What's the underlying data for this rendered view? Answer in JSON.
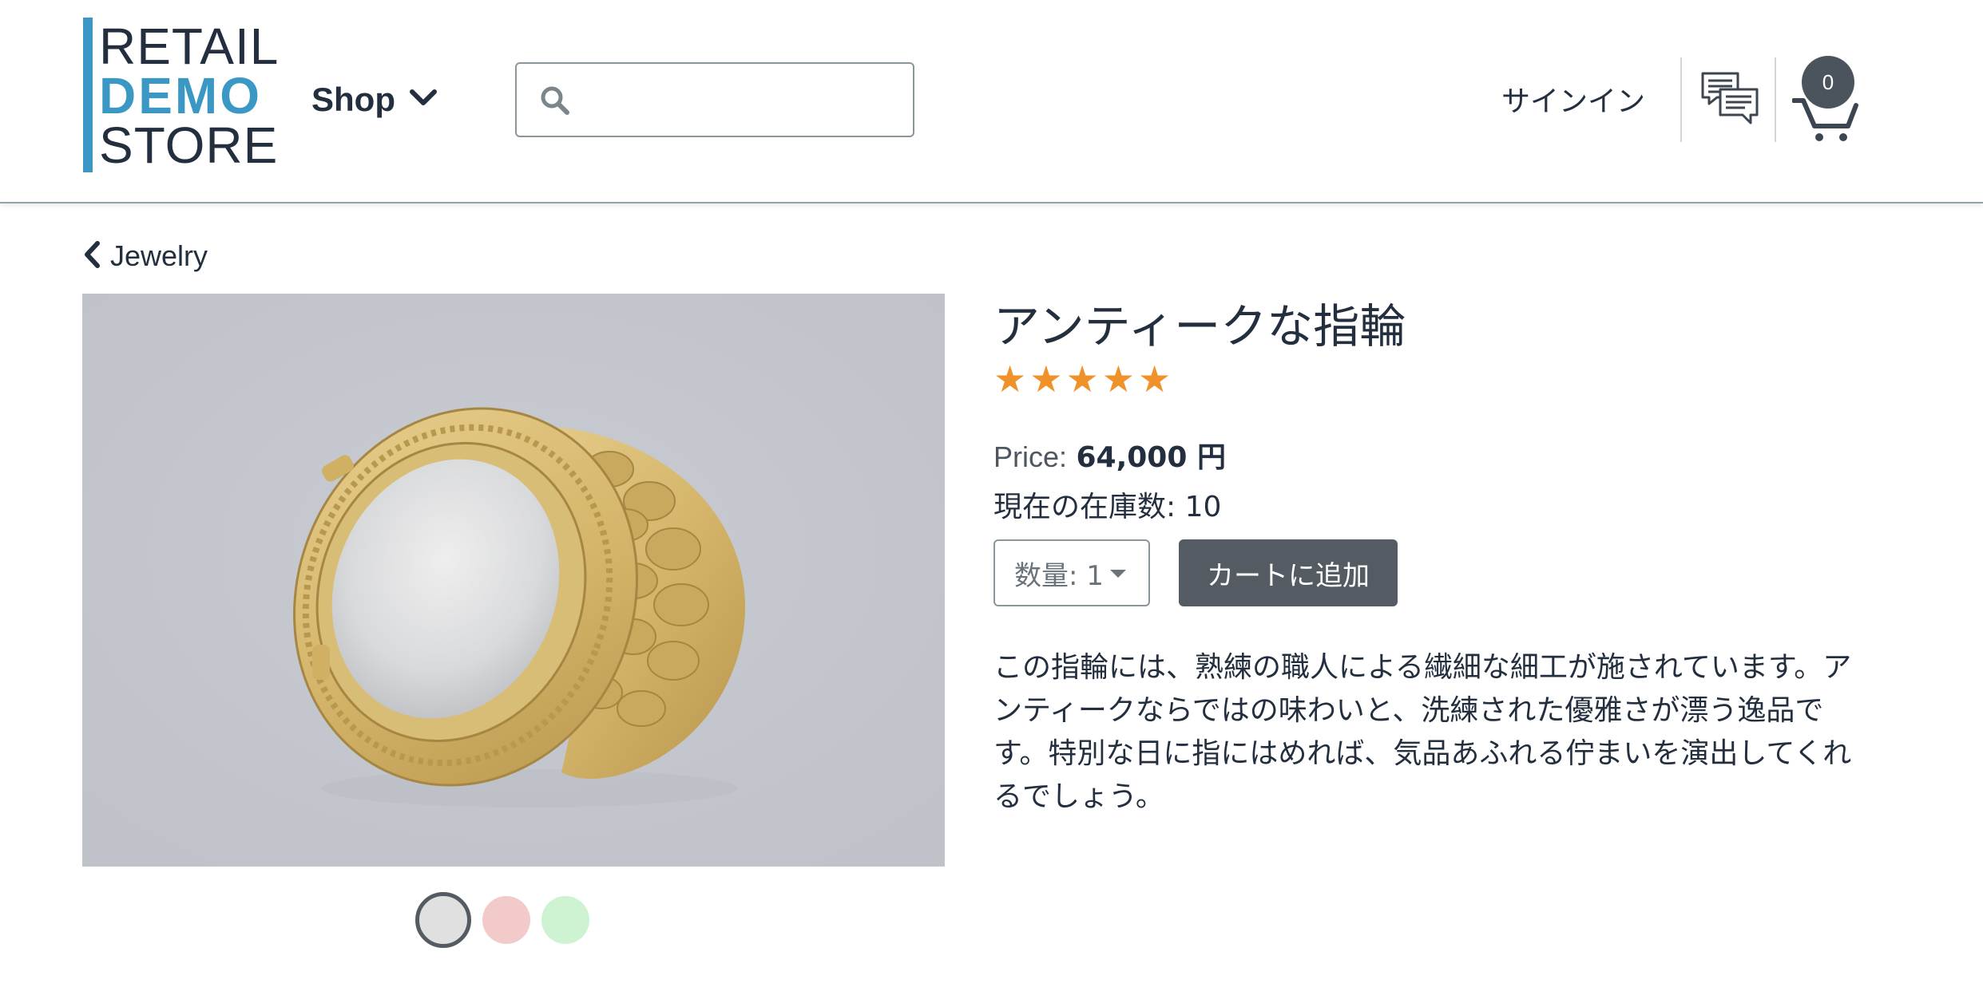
{
  "header": {
    "logo": {
      "line1": "RETAIL",
      "line2": "DEMO",
      "line3": "STORE"
    },
    "shop_label": "Shop",
    "search": {
      "placeholder": "",
      "value": ""
    },
    "signin_label": "サインイン",
    "cart_count": "0"
  },
  "breadcrumb": {
    "label": "Jewelry"
  },
  "product": {
    "title": "アンティークな指輪",
    "rating": 5,
    "price_label": "Price:",
    "price_value": "64,000 円",
    "stock_label": "現在の在庫数:",
    "stock_value": "10",
    "quantity_label": "数量: 1",
    "add_to_cart_label": "カートに追加",
    "description": "この指輪には、熟練の職人による繊細な細工が施されています。アンティークならではの味わいと、洗練された優雅さが漂う逸品です。特別な日に指にはめれば、気品あふれる佇まいを演出してくれるでしょう。",
    "swatches": [
      {
        "name": "gray",
        "color": "#e0e0e0",
        "selected": true
      },
      {
        "name": "pink",
        "color": "#f2caca",
        "selected": false
      },
      {
        "name": "green",
        "color": "#cdf3d2",
        "selected": false
      }
    ]
  },
  "colors": {
    "brand_blue": "#3b98c4",
    "dark_text": "#232f3e",
    "star": "#f0922a",
    "button": "#545b62",
    "image_bg": "#c3c6cd",
    "ring_gold": "#d7b86f"
  },
  "icons": [
    "search-icon",
    "chevron-down-icon",
    "chat-icon",
    "cart-icon",
    "chevron-left-icon",
    "star-icon"
  ]
}
